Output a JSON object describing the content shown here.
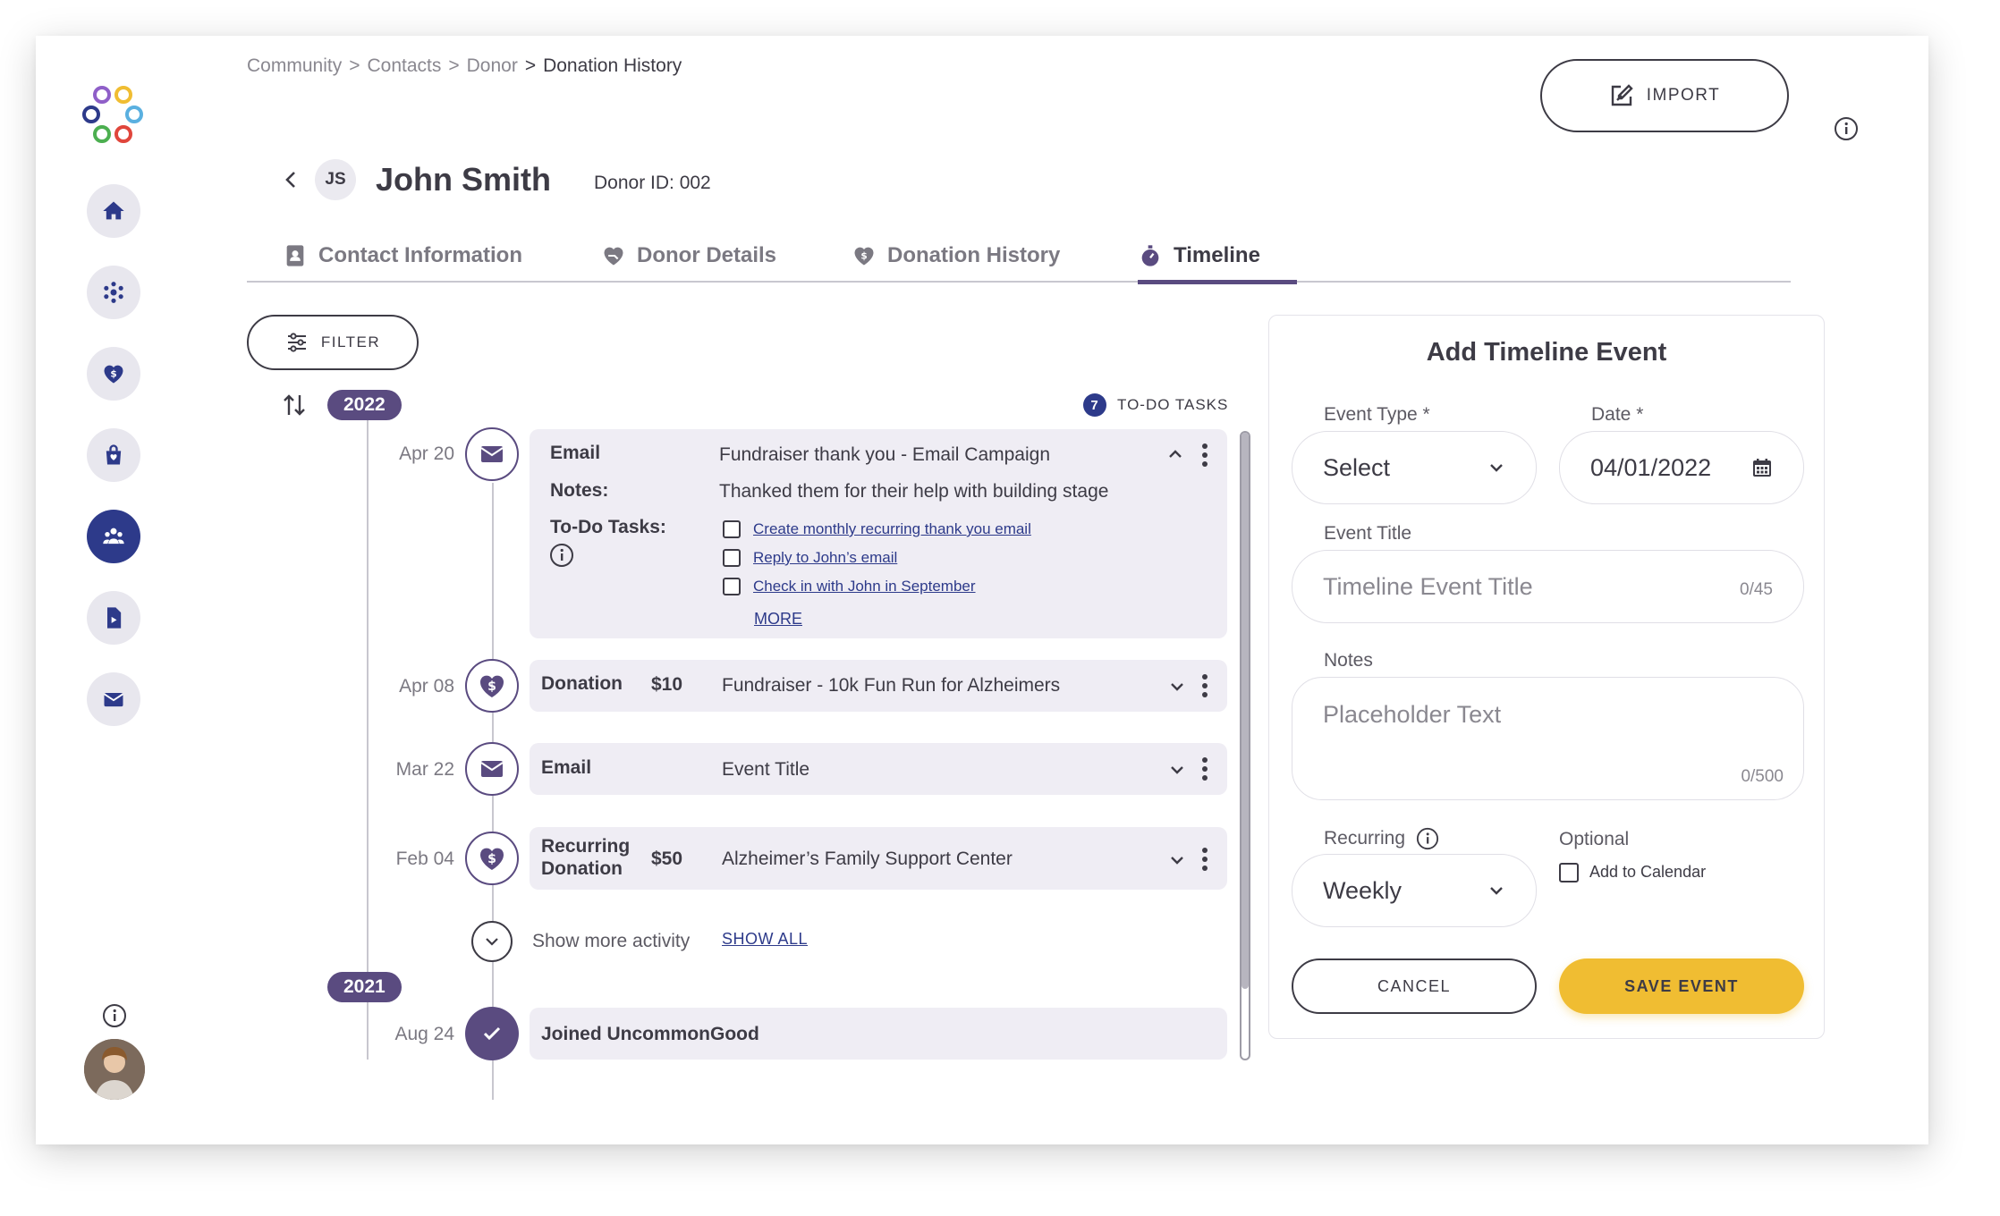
{
  "breadcrumb": {
    "items": [
      "Community",
      "Contacts",
      "Donor"
    ],
    "separator": ">",
    "current": "Donation History"
  },
  "header": {
    "initials": "JS",
    "name": "John Smith",
    "donor_id": "Donor ID: 002",
    "import_label": "IMPORT"
  },
  "sidebar": {
    "items": [
      "home-icon",
      "network-icon",
      "donation-icon",
      "shopping-bag-icon",
      "community-icon",
      "document-icon",
      "mail-icon"
    ],
    "active": "community-icon"
  },
  "tabs": [
    {
      "label": "Contact Information",
      "icon": "contact-book-icon"
    },
    {
      "label": "Donor Details",
      "icon": "heart-hand-icon"
    },
    {
      "label": "Donation History",
      "icon": "heart-dollar-icon"
    },
    {
      "label": "Timeline",
      "icon": "stopwatch-icon",
      "active": true
    }
  ],
  "timeline": {
    "filter_label": "FILTER",
    "todo": {
      "count": "7",
      "label": "TO-DO TASKS"
    },
    "year_2022": "2022",
    "year_2021": "2021",
    "email_event": {
      "date": "Apr 20",
      "type": "Email",
      "title": "Fundraiser thank you - Email Campaign",
      "notes_label": "Notes:",
      "notes": "Thanked them for their help with building stage",
      "tasks_label": "To-Do Tasks:",
      "tasks": [
        "Create monthly recurring thank you email",
        "Reply to John’s email",
        "Check in with John in September"
      ],
      "more": "MORE"
    },
    "events": [
      {
        "date": "Apr 08",
        "type": "Donation",
        "amount": "$10",
        "title": "Fundraiser - 10k Fun Run for Alzheimers"
      },
      {
        "date": "Mar 22",
        "type": "Email",
        "amount": "",
        "title": "Event Title"
      },
      {
        "date": "Feb 04",
        "type_line1": "Recurring",
        "type_line2": "Donation",
        "amount": "$50",
        "title": "Alzheimer’s Family Support Center"
      }
    ],
    "show_more": "Show more activity",
    "show_all": "SHOW ALL",
    "joined": {
      "date": "Aug 24",
      "title": "Joined UncommonGood"
    }
  },
  "form": {
    "title": "Add Timeline Event",
    "event_type_label": "Event Type *",
    "event_type_value": "Select",
    "date_label": "Date *",
    "date_value": "04/01/2022",
    "event_title_label": "Event Title",
    "event_title_placeholder": "Timeline Event Title",
    "event_title_counter": "0/45",
    "notes_label": "Notes",
    "notes_placeholder": "Placeholder Text",
    "notes_counter": "0/500",
    "recurring_label": "Recurring",
    "recurring_value": "Weekly",
    "optional_label": "Optional",
    "add_to_calendar": "Add to Calendar",
    "cancel": "CANCEL",
    "save": "SAVE EVENT"
  },
  "colors": {
    "brand_purple": "#5a4b80",
    "navy": "#2d3a8a",
    "save_yellow": "#f0bd32",
    "card_bg": "#efedf4"
  }
}
